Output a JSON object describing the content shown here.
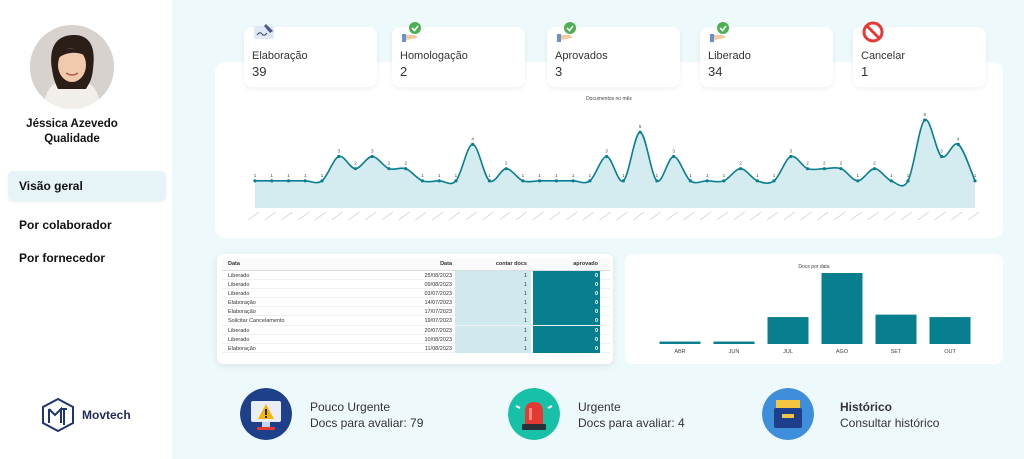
{
  "user": {
    "name": "Jéssica Azevedo",
    "role": "Qualidade"
  },
  "nav": [
    {
      "label": "Visão geral",
      "active": true
    },
    {
      "label": "Por colaborador",
      "active": false
    },
    {
      "label": "Por fornecedor",
      "active": false
    }
  ],
  "brand": {
    "name": "Movtech"
  },
  "status_cards": [
    {
      "label": "Elaboração",
      "value": "39",
      "icon": "signature-pen-icon"
    },
    {
      "label": "Homologação",
      "value": "2",
      "icon": "hand-check-icon"
    },
    {
      "label": "Aprovados",
      "value": "3",
      "icon": "hand-check-icon"
    },
    {
      "label": "Liberado",
      "value": "34",
      "icon": "hand-check-icon"
    },
    {
      "label": "Cancelar",
      "value": "1",
      "icon": "cancel-icon"
    }
  ],
  "line_chart": {
    "title": "Documentos no mês",
    "values": [
      1,
      1,
      1,
      1,
      1,
      3,
      2,
      3,
      2,
      2,
      1,
      1,
      1,
      4,
      1,
      2,
      1,
      1,
      1,
      1,
      1,
      3,
      1,
      5,
      1,
      3,
      1,
      1,
      1,
      2,
      1,
      1,
      3,
      2,
      2,
      2,
      1,
      2,
      1,
      1,
      6,
      3,
      4,
      1
    ]
  },
  "table": {
    "headers": [
      "Data",
      "Data",
      "contar docs",
      "aprovado"
    ],
    "rows": [
      [
        "Liberado",
        "25/08/2023",
        "1",
        "0"
      ],
      [
        "Liberado",
        "09/08/2023",
        "1",
        "0"
      ],
      [
        "Liberado",
        "03/07/2023",
        "1",
        "0"
      ],
      [
        "Elaboração",
        "14/07/2023",
        "1",
        "0"
      ],
      [
        "Elaboração",
        "17/07/2023",
        "1",
        "0"
      ],
      [
        "Solicitar Cancelamento",
        "19/07/2023",
        "1",
        "0"
      ],
      [
        "Liberado",
        "20/07/2023",
        "1",
        "0"
      ],
      [
        "Liberado",
        "10/08/2023",
        "1",
        "0"
      ],
      [
        "Elaboração",
        "11/08/2023",
        "1",
        "0"
      ]
    ]
  },
  "chart_data": [
    {
      "type": "line",
      "title": "Documentos no mês",
      "values": [
        1,
        1,
        1,
        1,
        1,
        3,
        2,
        3,
        2,
        2,
        1,
        1,
        1,
        4,
        1,
        2,
        1,
        1,
        1,
        1,
        1,
        3,
        1,
        5,
        1,
        3,
        1,
        1,
        1,
        2,
        1,
        1,
        3,
        2,
        2,
        2,
        1,
        2,
        1,
        1,
        6,
        3,
        4,
        1
      ],
      "grid": false
    },
    {
      "type": "bar",
      "title": "Docs por data",
      "categories": [
        "ABR",
        "JUN",
        "JUL",
        "AGO",
        "SET",
        "OUT"
      ],
      "values": [
        1,
        1,
        11,
        29,
        12,
        11
      ],
      "color": "#077f8e"
    }
  ],
  "alerts": [
    {
      "title": "Pouco Urgente",
      "subtitle": "Docs para avaliar: 79",
      "icon": "monitor-warning-icon"
    },
    {
      "title": "Urgente",
      "subtitle": "Docs para avaliar: 4",
      "icon": "siren-icon"
    },
    {
      "title": "Histórico",
      "subtitle": "Consultar histórico",
      "icon": "archive-box-icon"
    }
  ],
  "colors": {
    "accent": "#077f8e",
    "fill": "#c9e6ec",
    "background": "#eef9fb"
  }
}
